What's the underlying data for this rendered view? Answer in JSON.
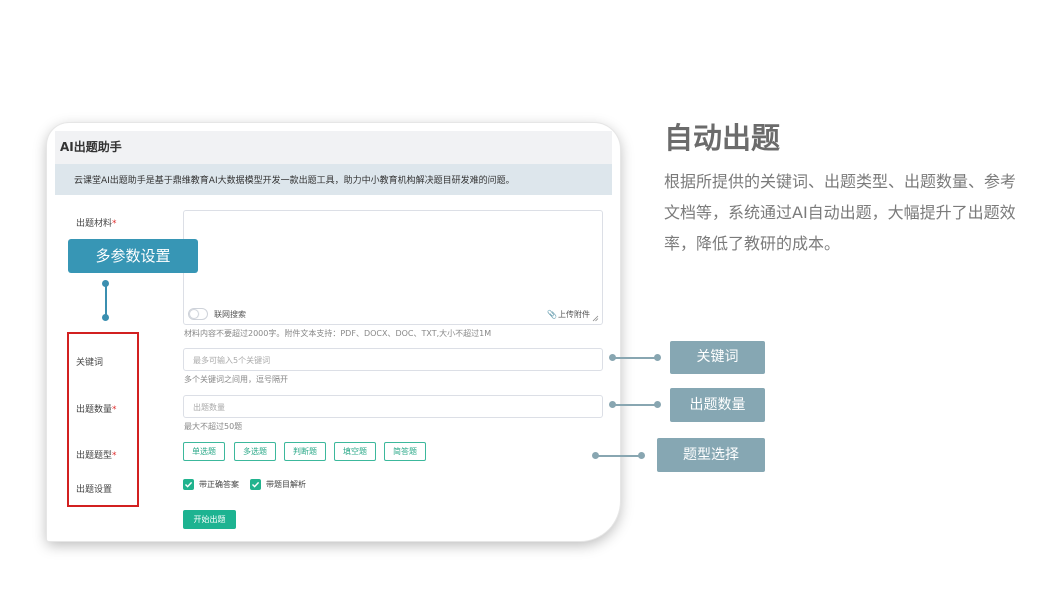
{
  "app": {
    "title": "AI出题助手",
    "intro": "云课堂AI出题助手是基于鼎维教育AI大数据模型开发一款出题工具，助力中小教育机构解决题目研发难的问题。"
  },
  "form": {
    "material_label": "出题材料",
    "required_mark": "*",
    "web_search_label": "联网搜索",
    "upload_label": "上传附件",
    "material_hint": "材料内容不要超过2000字。附件文本支持：PDF、DOCX、DOC、TXT,大小不超过1M",
    "keyword_label": "关键词",
    "keyword_placeholder": "最多可输入5个关键词",
    "keyword_hint": "多个关键词之间用，逗号隔开",
    "count_label": "出题数量",
    "count_placeholder": "出题数量",
    "count_hint": "最大不超过50题",
    "type_label": "出题题型",
    "types": [
      "单选题",
      "多选题",
      "判断题",
      "填空题",
      "简答题"
    ],
    "settings_label": "出题设置",
    "settings": [
      "带正确答案",
      "带题目解析"
    ],
    "start_button": "开始出题"
  },
  "annotations": {
    "multi_param": "多参数设置",
    "keyword": "关键词",
    "count": "出题数量",
    "type": "题型选择"
  },
  "feature": {
    "title": "自动出题",
    "description": "根据所提供的关键词、出题类型、出题数量、参考文档等，系统通过AI自动出题，大幅提升了出题效率，降低了教研的成本。"
  },
  "colors": {
    "accent_green": "#1db391",
    "annotation_blue": "#3796b5",
    "annotation_gray": "#86a7b3",
    "highlight_red": "#d22020"
  }
}
